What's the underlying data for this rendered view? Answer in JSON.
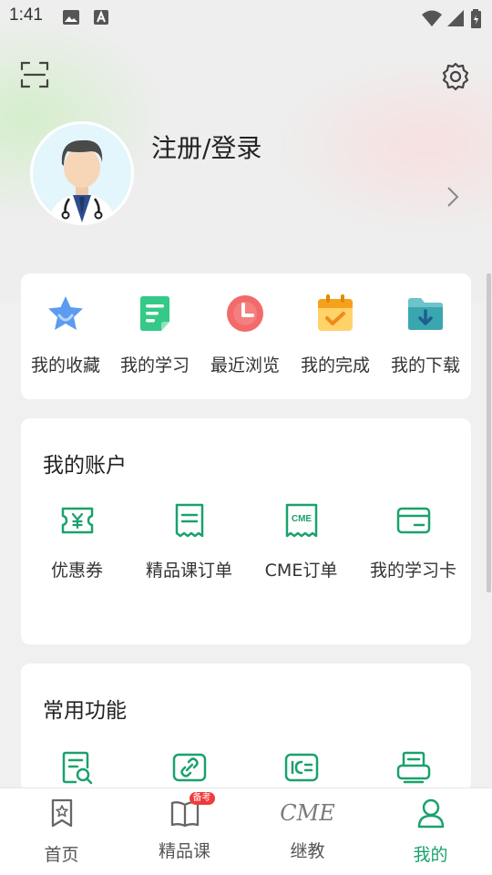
{
  "status_bar": {
    "time": "1:41"
  },
  "profile": {
    "login_label": "注册/登录"
  },
  "quick_actions": [
    {
      "label": "我的收藏",
      "icon": "star-icon"
    },
    {
      "label": "我的学习",
      "icon": "study-doc-icon"
    },
    {
      "label": "最近浏览",
      "icon": "clock-icon"
    },
    {
      "label": "我的完成",
      "icon": "calendar-check-icon"
    },
    {
      "label": "我的下载",
      "icon": "download-folder-icon"
    }
  ],
  "account": {
    "title": "我的账户",
    "items": [
      {
        "label": "优惠券",
        "icon": "coupon-icon"
      },
      {
        "label": "精品课订单",
        "icon": "receipt-icon"
      },
      {
        "label": "CME订单",
        "icon": "cme-receipt-icon"
      },
      {
        "label": "我的学习卡",
        "icon": "card-icon"
      }
    ]
  },
  "functions": {
    "title": "常用功能",
    "items": [
      {
        "icon": "document-search-icon"
      },
      {
        "icon": "link-icon"
      },
      {
        "icon": "ic-card-icon"
      },
      {
        "icon": "printer-icon"
      }
    ]
  },
  "cme_icon_text": "CME",
  "tabs": [
    {
      "label": "首页",
      "icon": "home-bookmark-icon"
    },
    {
      "label": "精品课",
      "icon": "book-icon",
      "badge": "备考"
    },
    {
      "label": "继教",
      "icon": "cme-logo",
      "logo_text": "CME"
    },
    {
      "label": "我的",
      "icon": "person-icon",
      "active": true
    }
  ],
  "colors": {
    "accent": "#1aa26b",
    "badge": "#ef3b3b"
  }
}
